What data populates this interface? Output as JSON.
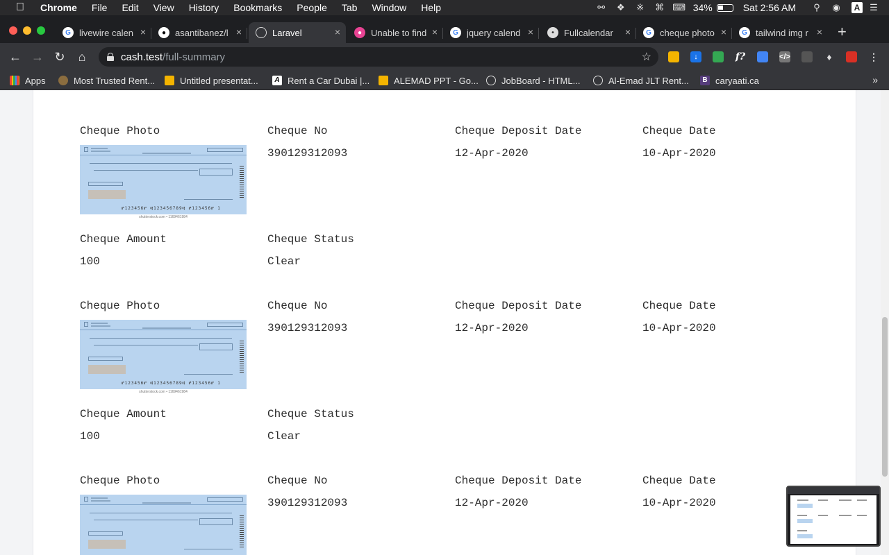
{
  "menubar": {
    "app_name": "Chrome",
    "items": [
      "File",
      "Edit",
      "View",
      "History",
      "Bookmarks",
      "People",
      "Tab",
      "Window",
      "Help"
    ],
    "battery_percent": "34%",
    "clock": "Sat 2:56 AM",
    "input_source": "A"
  },
  "tabs": [
    {
      "label": "livewire calen",
      "icon": "google-icon"
    },
    {
      "label": "asantibanez/l",
      "icon": "github-icon"
    },
    {
      "label": "Laravel",
      "icon": "globe-icon",
      "active": true
    },
    {
      "label": "Unable to find",
      "icon": "bug-icon"
    },
    {
      "label": "jquery calend",
      "icon": "google-icon"
    },
    {
      "label": "Fullcalendar",
      "icon": "site-icon"
    },
    {
      "label": "cheque photo",
      "icon": "google-icon"
    },
    {
      "label": "tailwind img r",
      "icon": "google-icon"
    }
  ],
  "address_bar": {
    "host": "cash.test",
    "path": "/full-summary"
  },
  "bookmarks": [
    {
      "label": "Apps",
      "icon": "apps-grid-icon"
    },
    {
      "label": "Most Trusted Rent...",
      "icon": "site-icon"
    },
    {
      "label": "Untitled presentat...",
      "icon": "slides-icon"
    },
    {
      "label": "Rent a Car Dubai |...",
      "icon": "site-icon"
    },
    {
      "label": "ALEMAD PPT - Go...",
      "icon": "slides-icon"
    },
    {
      "label": "JobBoard - HTML...",
      "icon": "globe-icon"
    },
    {
      "label": "Al-Emad JLT Rent...",
      "icon": "globe-icon"
    },
    {
      "label": "caryaati.ca",
      "icon": "bootstrap-icon"
    }
  ],
  "labels": {
    "cheque_photo": "Cheque Photo",
    "cheque_no": "Cheque No",
    "deposit_date": "Cheque Deposit Date",
    "cheque_date": "Cheque Date",
    "amount": "Cheque Amount",
    "status": "Cheque Status"
  },
  "cheques": [
    {
      "number": "390129312093",
      "deposit_date": "12-Apr-2020",
      "date": "10-Apr-2020",
      "amount": "100",
      "status": "Clear"
    },
    {
      "number": "390129312093",
      "deposit_date": "12-Apr-2020",
      "date": "10-Apr-2020",
      "amount": "100",
      "status": "Clear"
    },
    {
      "number": "390129312093",
      "deposit_date": "12-Apr-2020",
      "date": "10-Apr-2020"
    }
  ],
  "cheque_image": {
    "micr": "⑈123456⑈ ⑆123456789⑆ ⑈123456⑈ 1",
    "caption": "shutterstock.com • 1169461984"
  },
  "colors": {
    "menubar_bg": "#2a2a2c",
    "chrome_dark": "#35363a",
    "page_bg": "#f3f4f6",
    "cheque_blue": "#b9d4ef",
    "text": "#2d2d2d"
  }
}
